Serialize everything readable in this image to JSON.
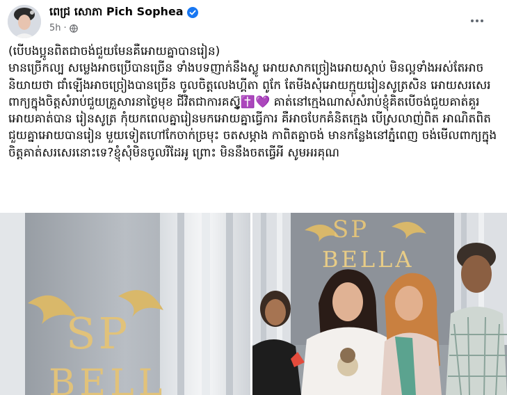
{
  "post": {
    "author": "ពេជ្រ សោភា Pich Sophea",
    "time": "5h",
    "text": "(បើបងប្អូនពិតជាចង់ជួយមែនគឺអោយគ្នាបានរៀន)\nមានច្រើកល្ប សម្លេងអាចប្រើបានច្រើន ទាំងបទញាក់នឹងស្លូ អោយសាកច្រៀងអោយស្ដាប់ មិនល្អទាំងអស់តែអាចនិយាយថា ជាំឡើងអាចច្រៀងបានច្រើន ចូលចិត្តលេងហ្គីតា ពូកែ តែមីងសុំអោយក្មួយរៀនសូត្រសិន អោយសរសេរពាក្យក្នុងចិត្តសំរាប់ជួយគ្រួសារនាថ្ងៃមុខ ជីវិតជាការគស្ទ៊ូ✝️💜 គាត់នៅក្មេងណាស់សំរាប់ខ្ញុំគិតបើចង់ជួយគាត់គួរអោយគាត់បាន រៀនសូត្រ កុំយកពេលគ្នារៀនមកអោយគ្នាធ្វើការ គឺអាចបែកគំនិតក្មេង បើស្រលាញ់ពិត អាណិតពិត ជួយគ្នាអោយបានរៀន មួយទៀតហៅកែចាក់ច្រមុះ ចតសម្ភាង កាពិតគ្នាចង់ មានកន្លែងនៅភ្នំពេញ ចង់មើលពាក្យក្នុងចិត្តគាត់សរសេរនោះទេ?ខ្ញុំសុំមិនចូលរីដែអូ ព្រោះ មិននឹងចតធ្វើអី សូមអរគុណ",
    "photo_left_sign": "SP BELLA",
    "photo_right_sign_top": "SP",
    "photo_right_sign_bottom": "BELLA"
  },
  "colors": {
    "verified": "#1877f2",
    "meta": "#65676b",
    "text": "#050505"
  },
  "icons": {
    "verified": "verified-badge-icon",
    "privacy": "globe-icon",
    "more": "more-options-icon"
  }
}
